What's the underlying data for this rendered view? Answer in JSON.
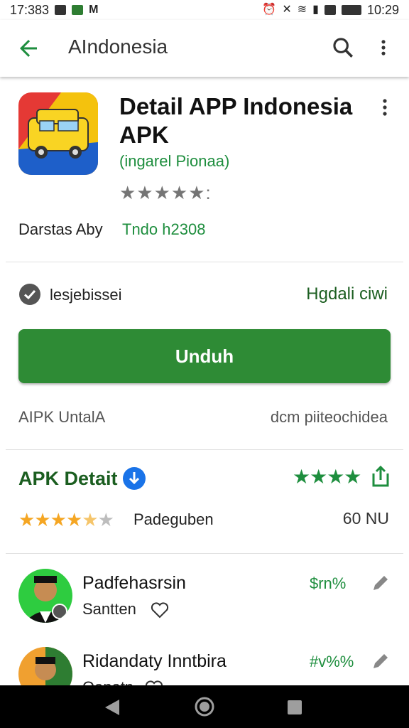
{
  "status_bar": {
    "time": "17:383",
    "clock": "10:29"
  },
  "app_bar": {
    "title": "AIndonesia",
    "icons": [
      "arrow-back-icon",
      "search-icon",
      "more-vert-icon"
    ]
  },
  "app": {
    "title": "Detail APP Indonesia APK",
    "developer": "(ingarel Pionaa)",
    "stars": "★★★★★:",
    "meta_label": "Darstas Aby",
    "meta_value": "Tndo h2308"
  },
  "verify": {
    "label": "lesjebissei",
    "link": "Hgdali ciwi"
  },
  "download": {
    "label": "Unduh"
  },
  "info": {
    "left": "AIPK UntalA",
    "right": "dcm piiteochidea"
  },
  "section": {
    "title": "APK Detait",
    "green_stars": "★★★★",
    "rating_label": "Padeguben",
    "rating_count": "60 NU",
    "rating_value": 4.5
  },
  "reviews": [
    {
      "name": "Padfehasrsin",
      "sub": "Santten",
      "score": "$rn%"
    },
    {
      "name": "Ridandaty Inntbira",
      "sub": "Qanatn",
      "score": "#v%%"
    }
  ],
  "colors": {
    "primary_green": "#2e8b35",
    "text_green": "#1e8e3e",
    "star_yellow": "#f5a623"
  }
}
